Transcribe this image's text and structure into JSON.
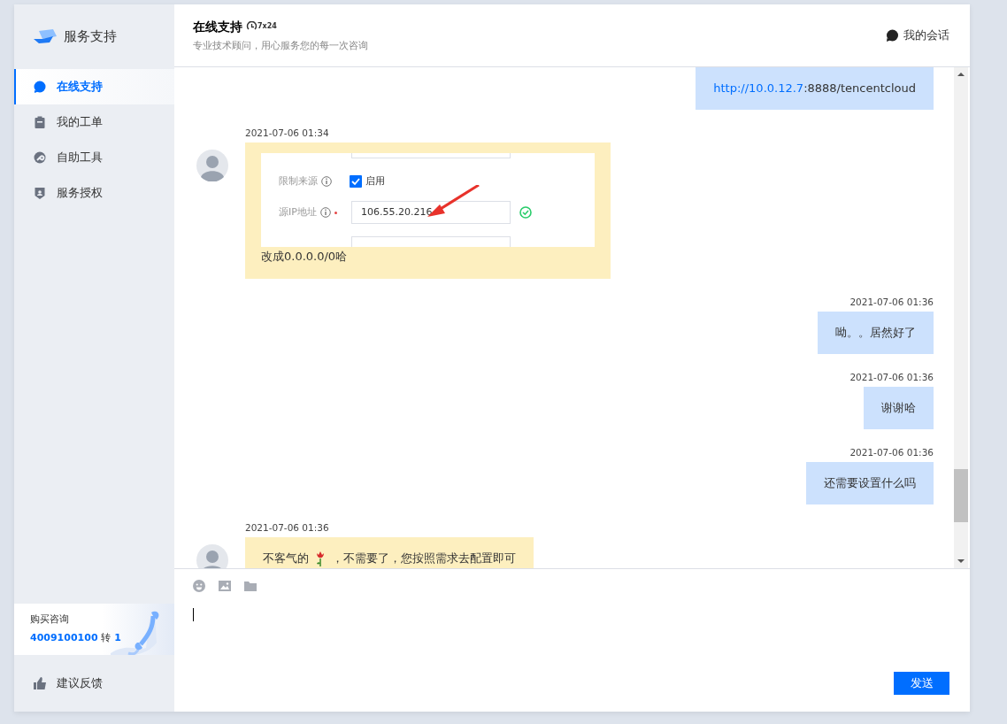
{
  "sidebar": {
    "logo_text": "服务支持",
    "nav": [
      {
        "label": "在线支持",
        "selected": true
      },
      {
        "label": "我的工单",
        "selected": false
      },
      {
        "label": "自助工具",
        "selected": false
      },
      {
        "label": "服务授权",
        "selected": false
      }
    ],
    "promo": {
      "title": "购买咨询",
      "phone": "4009100100",
      "ext_word": "转",
      "ext": "1"
    },
    "feedback": "建议反馈"
  },
  "header": {
    "title": "在线支持",
    "badge": "7x24",
    "subtitle": "专业技术顾问，用心服务您的每一次咨询",
    "sessions": "我的会话"
  },
  "messages": [
    {
      "kind": "link",
      "incoming": false,
      "link": "http://10.0.12.7",
      "text": ":8888/tencentcloud"
    },
    {
      "kind": "image",
      "incoming": true,
      "time": "2021-07-06 01:34",
      "shot": [
        {
          "kind": "checkbox",
          "label": "限制来源",
          "value": "启用",
          "checked": true
        },
        {
          "kind": "input",
          "label": "源IP地址",
          "required": true,
          "value": "106.55.20.216",
          "valid": true
        }
      ],
      "text": "改成0.0.0.0/0哈"
    },
    {
      "kind": "text",
      "incoming": false,
      "time": "2021-07-06 01:36",
      "text": "呦。。居然好了"
    },
    {
      "kind": "text",
      "incoming": false,
      "time": "2021-07-06 01:36",
      "text": "谢谢哈"
    },
    {
      "kind": "text",
      "incoming": false,
      "time": "2021-07-06 01:36",
      "text": "还需要设置什么吗"
    },
    {
      "kind": "text",
      "incoming": true,
      "time": "2021-07-06 01:36",
      "text": "不客气的",
      "emoji": true,
      "text_after": "，不需要了，您按照需求去配置即可"
    }
  ],
  "composer": {
    "send": "发送"
  }
}
